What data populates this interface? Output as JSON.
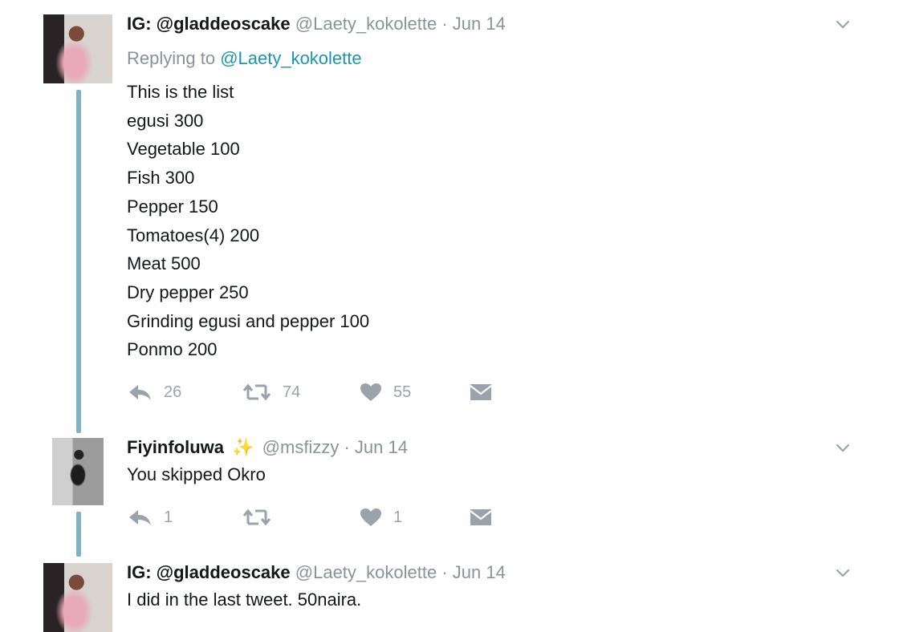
{
  "tweets": [
    {
      "name": "IG: @gladdeoscake",
      "handle": "@Laety_kokolette",
      "sep": "·",
      "date": "Jun 14",
      "replying_prefix": "Replying to ",
      "replying_to": "@Laety_kokolette",
      "lines": [
        "This is the list",
        "egusi 300",
        "Vegetable 100",
        "Fish 300",
        "Pepper 150",
        "Tomatoes(4) 200",
        "Meat 500",
        "Dry pepper 250",
        "Grinding egusi and pepper 100",
        "Ponmo 200"
      ],
      "replies": "26",
      "retweets": "74",
      "likes": "55"
    },
    {
      "name": "Fiyinfoluwa",
      "emoji": "✨",
      "handle": "@msfizzy",
      "sep": "·",
      "date": "Jun 14",
      "text": "You skipped Okro",
      "replies": "1",
      "retweets": "",
      "likes": "1"
    },
    {
      "name": "IG: @gladdeoscake",
      "handle": "@Laety_kokolette",
      "sep": "·",
      "date": "Jun 14",
      "text": "I did in the last tweet. 50naira."
    }
  ],
  "colors": {
    "thread_line": "#7fb3c3",
    "link": "#1b95b0",
    "muted": "#8b9299",
    "action_icon": "#9aa3ab"
  },
  "icons": [
    "reply-icon",
    "retweet-icon",
    "heart-icon",
    "message-icon",
    "chevron-down-icon"
  ]
}
